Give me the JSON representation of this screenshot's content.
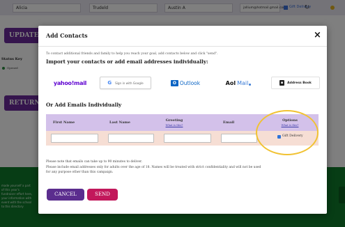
{
  "background": {
    "row_fields": [
      "Alicia",
      "Trudeld",
      "Austin A",
      "jallium@hotmail.gmail.com"
    ],
    "gift_delivery_label": "Gift Delivery",
    "update_button": "UPDATE",
    "status_key_label": "Status Key",
    "opened_label": "Opened",
    "return_button": "RETURN",
    "footer_text": "made yourself a part of this year's fundraiser effort here, your information with event with the school to this directory"
  },
  "modal": {
    "title": "Add Contacts",
    "close_label": "×",
    "intro": "To contact additional friends and family to help you reach your goal, add contacts below and click \"send\".",
    "import_heading": "Import your contacts or add email addresses individually:",
    "providers": {
      "yahoo": "yahoo!mail",
      "google_g": "G",
      "google": "Sign in with Google",
      "outlook_o": "O",
      "outlook": "Outlook",
      "aol": "Aol",
      "aol_mail": "Mail",
      "address_book_icon": "▪",
      "address_book": "Address Book"
    },
    "or_heading": "Or Add Emails Individually",
    "table": {
      "first_name": "First Name",
      "last_name": "Last Name",
      "greeting": "Greeting",
      "greeting_link": "What is this?",
      "email": "Email",
      "options": "Options",
      "options_link": "What is this?",
      "gift_delivery": "Gift Delivery"
    },
    "notes": [
      "Please note that emails can take up to 90 minutes to deliver.",
      "Please include email addresses only for adults over the age of 18. Names will be treated with strict confidentiality and will not be used",
      "for any purpose other than this campaign."
    ],
    "cancel_label": "CANCEL",
    "send_label": "SEND"
  },
  "icons": {
    "close": "close-icon",
    "checkbox": "checkbox-icon",
    "refresh": "refresh-icon",
    "address_book": "address-book-icon"
  },
  "colors": {
    "purple_button": "#5b2d8e",
    "send_button": "#c2185b",
    "table_header": "#d3c1ea",
    "table_row": "#f6ded4",
    "highlight_ring": "#f1c232",
    "footer_green": "#0f7a2a"
  }
}
